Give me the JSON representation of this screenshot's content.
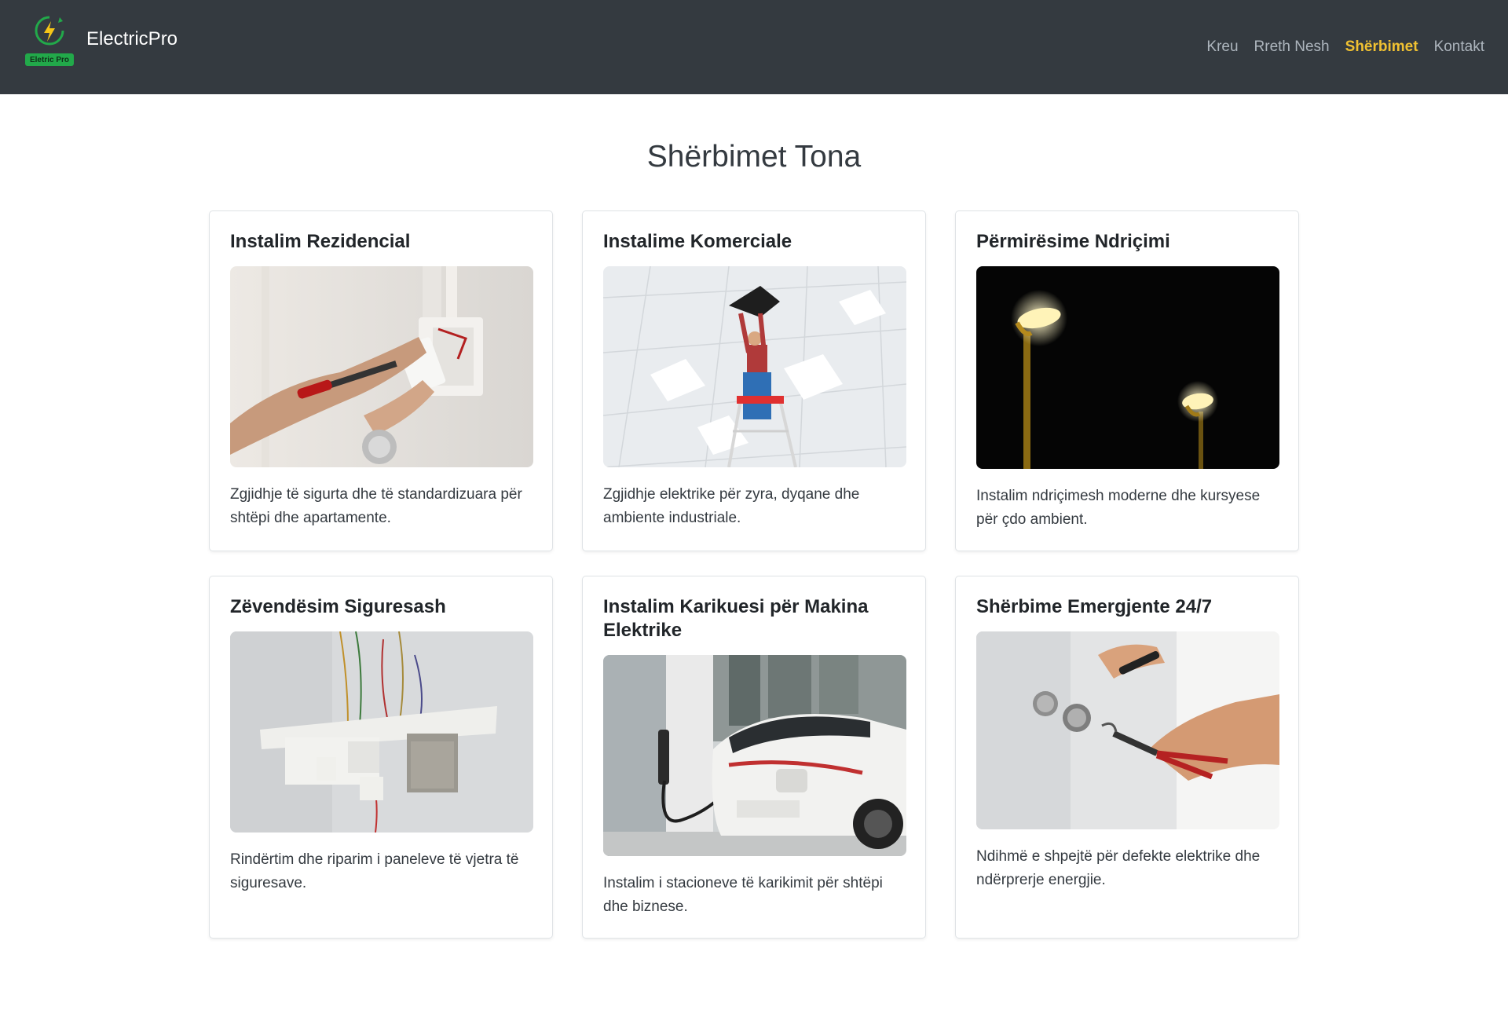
{
  "brand": {
    "name": "ElectricPro",
    "logo_badge": "Eletric Pro"
  },
  "nav": [
    {
      "label": "Kreu",
      "active": false
    },
    {
      "label": "Rreth Nesh",
      "active": false
    },
    {
      "label": "Shërbimet",
      "active": true
    },
    {
      "label": "Kontakt",
      "active": false
    }
  ],
  "page": {
    "title": "Shërbimet Tona"
  },
  "services": [
    {
      "title": "Instalim Rezidencial",
      "image": "hand-screwdriver-outlet-photo",
      "description": "Zgjidhje të sigurta dhe të standardizuara për shtëpi dhe apartamente."
    },
    {
      "title": "Instalime Komerciale",
      "image": "electrician-on-ladder-ceiling-photo",
      "description": "Zgjidhje elektrike për zyra, dyqane dhe ambiente industriale."
    },
    {
      "title": "Përmirësime Ndriçimi",
      "image": "street-lamps-night-photo",
      "description": "Instalim ndriçimesh moderne dhe kursyese për çdo ambient."
    },
    {
      "title": "Zëvendësim Siguresash",
      "image": "broken-fuse-panel-photo",
      "description": "Rindërtim dhe riparim i paneleve të vjetra të siguresave."
    },
    {
      "title": "Instalim Karikuesi për Makina Elektrike",
      "image": "ev-charging-car-photo",
      "description": "Instalim i stacioneve të karikimit për shtëpi dhe biznese."
    },
    {
      "title": "Shërbime Emergjente 24/7",
      "image": "hands-pliers-wall-socket-photo",
      "description": "Ndihmë e shpejtë për defekte elektrike dhe ndërprerje energjie."
    }
  ],
  "colors": {
    "navbar": "#343a40",
    "nav_active": "#f1c232",
    "nav_link": "#adb5bd",
    "logo_badge": "#22a94a"
  }
}
